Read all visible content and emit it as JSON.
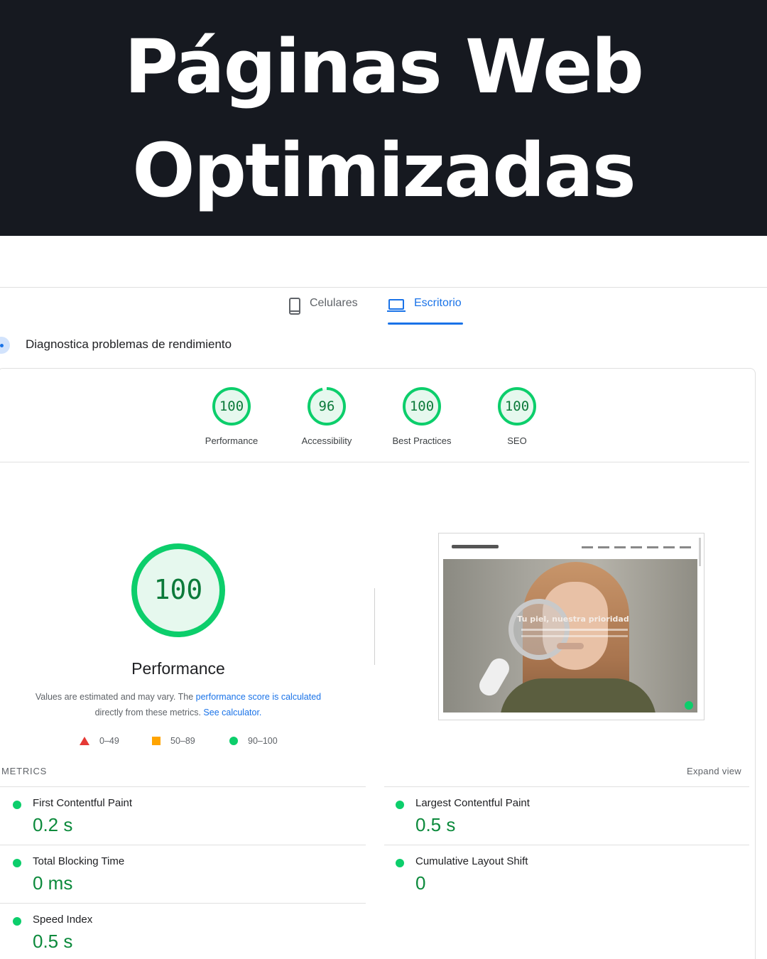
{
  "hero": {
    "line1": "Páginas Web",
    "line2": "Optimizadas"
  },
  "tabs": [
    {
      "label": "Celulares",
      "icon": "smartphone-icon",
      "active": false
    },
    {
      "label": "Escritorio",
      "icon": "laptop-icon",
      "active": true
    }
  ],
  "diagnostic": {
    "label": "Diagnostica problemas de rendimiento"
  },
  "categories": [
    {
      "score": "100",
      "label": "Performance",
      "fraction": 1.0
    },
    {
      "score": "96",
      "label": "Accessibility",
      "fraction": 0.96
    },
    {
      "score": "100",
      "label": "Best Practices",
      "fraction": 1.0
    },
    {
      "score": "100",
      "label": "SEO",
      "fraction": 1.0
    }
  ],
  "performance": {
    "score": "100",
    "fraction": 1.0,
    "title": "Performance",
    "desc_prefix": "Values are estimated and may vary. The ",
    "desc_link1": "performance score is calculated",
    "desc_middle": " directly from these metrics. ",
    "desc_link2": "See calculator."
  },
  "legend": [
    {
      "range": "0–49",
      "shape": "triangle",
      "color": "#e53935"
    },
    {
      "range": "50–89",
      "shape": "square",
      "color": "#ffa400"
    },
    {
      "range": "90–100",
      "shape": "circle",
      "color": "#0cce6b"
    }
  ],
  "screenshot": {
    "headline": "Tu piel, nuestra prioridad"
  },
  "metrics": {
    "title": "METRICS",
    "expand": "Expand view",
    "items": [
      {
        "label": "First Contentful Paint",
        "value": "0.2 s"
      },
      {
        "label": "Largest Contentful Paint",
        "value": "0.5 s"
      },
      {
        "label": "Total Blocking Time",
        "value": "0 ms"
      },
      {
        "label": "Cumulative Layout Shift",
        "value": "0"
      },
      {
        "label": "Speed Index",
        "value": "0.5 s"
      }
    ]
  },
  "colors": {
    "pass": "#0cce6b",
    "pass_text": "#0c7a3a",
    "accent": "#1a73e8",
    "header_bg": "#161920"
  }
}
